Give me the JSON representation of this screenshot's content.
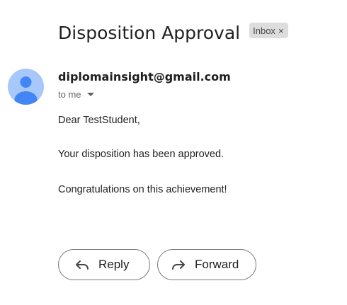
{
  "email": {
    "subject": "Disposition Approval",
    "label": "Inbox",
    "label_close": "×",
    "sender": "diplomainsight@gmail.com",
    "recipient": "to me",
    "body": [
      "Dear TestStudent,",
      "Your disposition has been approved.",
      "Congratulations on this achievement!"
    ]
  },
  "actions": {
    "reply_label": "Reply",
    "forward_label": "Forward"
  },
  "colors": {
    "avatar_bg": "#a8c7fa",
    "avatar_fg": "#4285f4",
    "chip_bg": "#dddddd"
  },
  "icons": {
    "avatar": "person-icon",
    "reply": "reply-arrow-icon",
    "forward": "forward-arrow-icon",
    "recipient_toggle": "caret-down-icon",
    "label_remove": "close-icon"
  }
}
